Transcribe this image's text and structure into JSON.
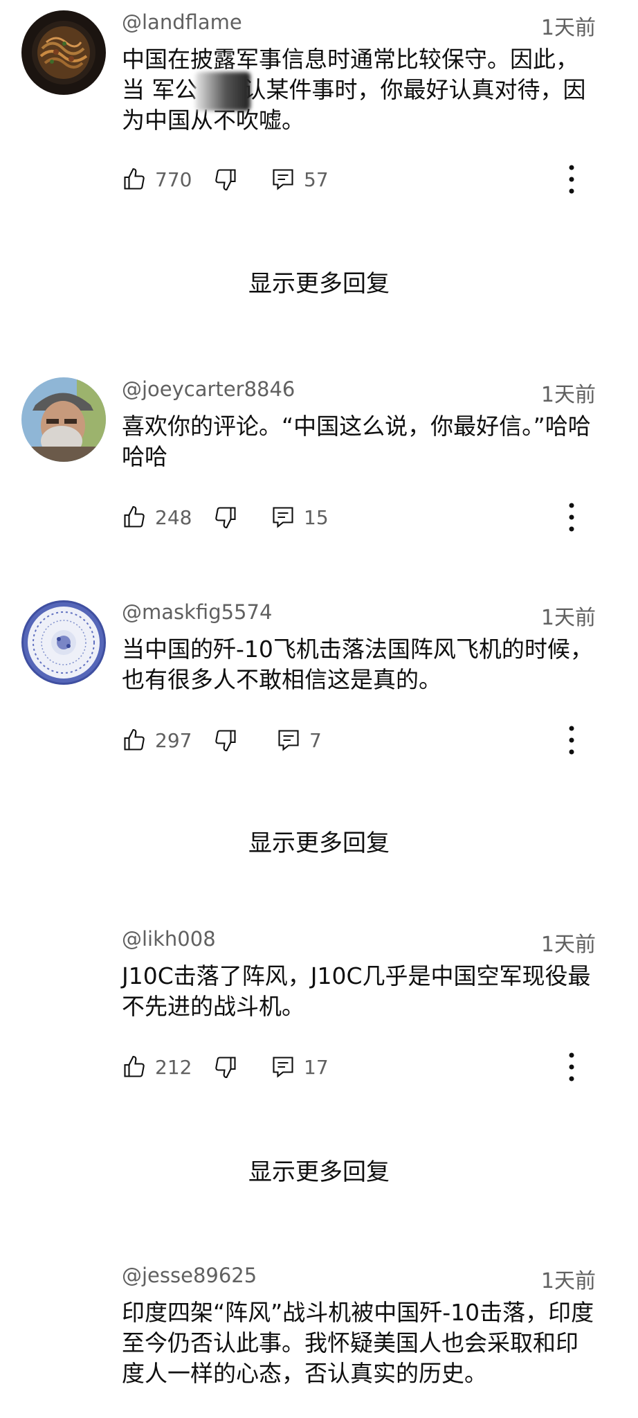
{
  "comments": [
    {
      "user": "@landflame",
      "time": "1天前",
      "text": "中国在披露军事信息时通常比较保守。因此，当  军公开确认某件事时，你最好认真对待，因为中国从不吹嘘。",
      "likes": "770",
      "replies": "57",
      "avatar_icon": "noodle-bowl-avatar"
    },
    {
      "user": "@joeycarter8846",
      "time": "1天前",
      "text": "喜欢你的评论。“中国这么说，你最好信。”哈哈哈哈",
      "likes": "248",
      "replies": "15",
      "avatar_icon": "bearded-man-avatar"
    },
    {
      "user": "@maskfig5574",
      "time": "1天前",
      "text": "当中国的歼-10飞机击落法国阵风飞机的时候，也有很多人不敢相信这是真的。",
      "likes": "297",
      "replies": "7",
      "avatar_icon": "porcelain-plate-avatar"
    },
    {
      "user": "@likh008",
      "time": "1天前",
      "text": "J10C击落了阵风，J10C几乎是中国空军现役最不先进的战斗机。",
      "likes": "212",
      "replies": "17"
    },
    {
      "user": "@jesse89625",
      "time": "1天前",
      "text": "印度四架“阵风”战斗机被中国歼-10击落，印度至今仍否认此事。我怀疑美国人也会采取和印度人一样的心态，否认真实的历史。"
    }
  ],
  "show_more_label": "显示更多回复",
  "colors": {
    "text": "#0f0f0f",
    "secondary": "#606060",
    "background": "#ffffff"
  }
}
